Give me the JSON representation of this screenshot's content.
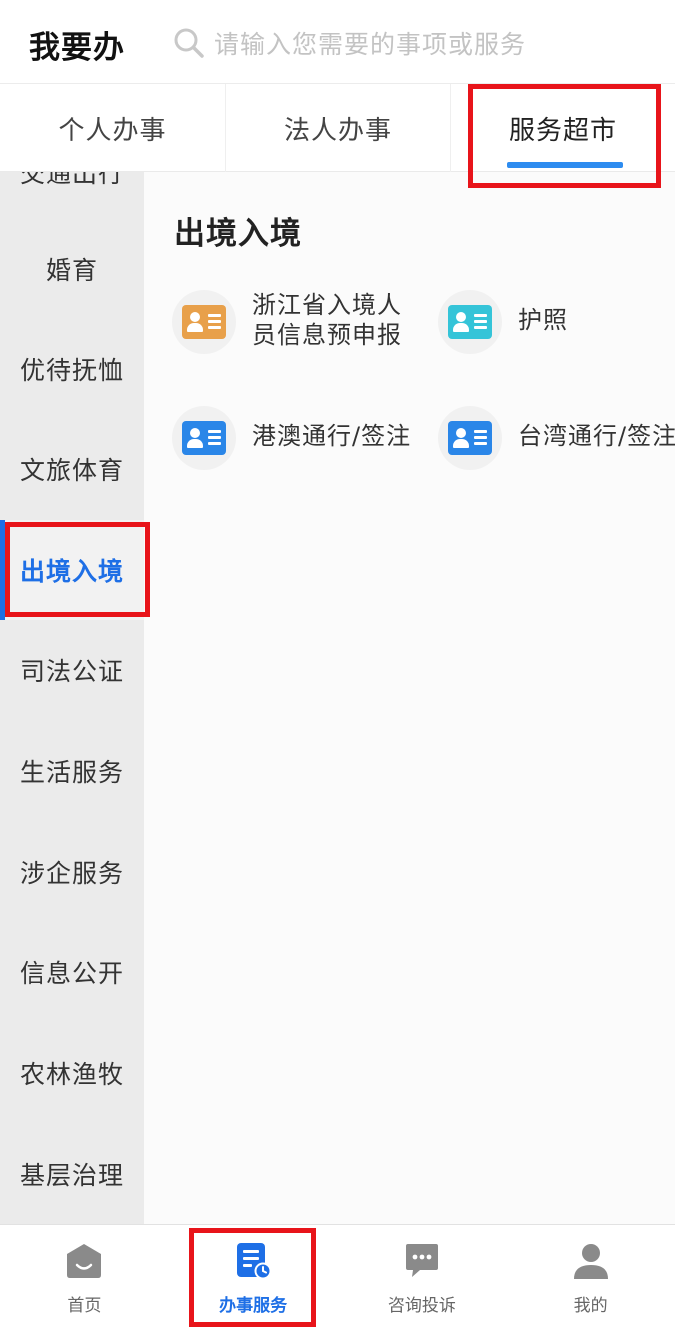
{
  "header": {
    "title": "我要办",
    "search_placeholder": "请输入您需要的事项或服务"
  },
  "tabs": [
    {
      "label": "个人办事",
      "active": false
    },
    {
      "label": "法人办事",
      "active": false
    },
    {
      "label": "服务超市",
      "active": true
    }
  ],
  "sidebar": {
    "partial_top_label": "交通出行",
    "items": [
      {
        "label": "婚育"
      },
      {
        "label": "优待抚恤"
      },
      {
        "label": "文旅体育"
      },
      {
        "label": "出境入境",
        "active": true
      },
      {
        "label": "司法公证"
      },
      {
        "label": "生活服务"
      },
      {
        "label": "涉企服务"
      },
      {
        "label": "信息公开"
      },
      {
        "label": "农林渔牧"
      },
      {
        "label": "基层治理"
      }
    ]
  },
  "content": {
    "section_title": "出境入境",
    "services": [
      {
        "name": "浙江省入境人员信息预申报",
        "icon": "id-card-icon",
        "color": "#e8a04a"
      },
      {
        "name": "护照",
        "icon": "id-card-icon",
        "color": "#35c4d8"
      },
      {
        "name": "港澳通行/签注",
        "icon": "id-card-icon",
        "color": "#2a86e8"
      },
      {
        "name": "台湾通行/签注",
        "icon": "id-card-icon",
        "color": "#2a86e8"
      }
    ]
  },
  "bottom_nav": [
    {
      "label": "首页",
      "icon": "home-icon",
      "active": false
    },
    {
      "label": "办事服务",
      "icon": "document-clock-icon",
      "active": true
    },
    {
      "label": "咨询投诉",
      "icon": "chat-bubble-icon",
      "active": false
    },
    {
      "label": "我的",
      "icon": "user-icon",
      "active": false
    }
  ],
  "colors": {
    "accent": "#1e6fe6",
    "tab_underline": "#2d8cf0",
    "highlight": "#e8141a"
  }
}
